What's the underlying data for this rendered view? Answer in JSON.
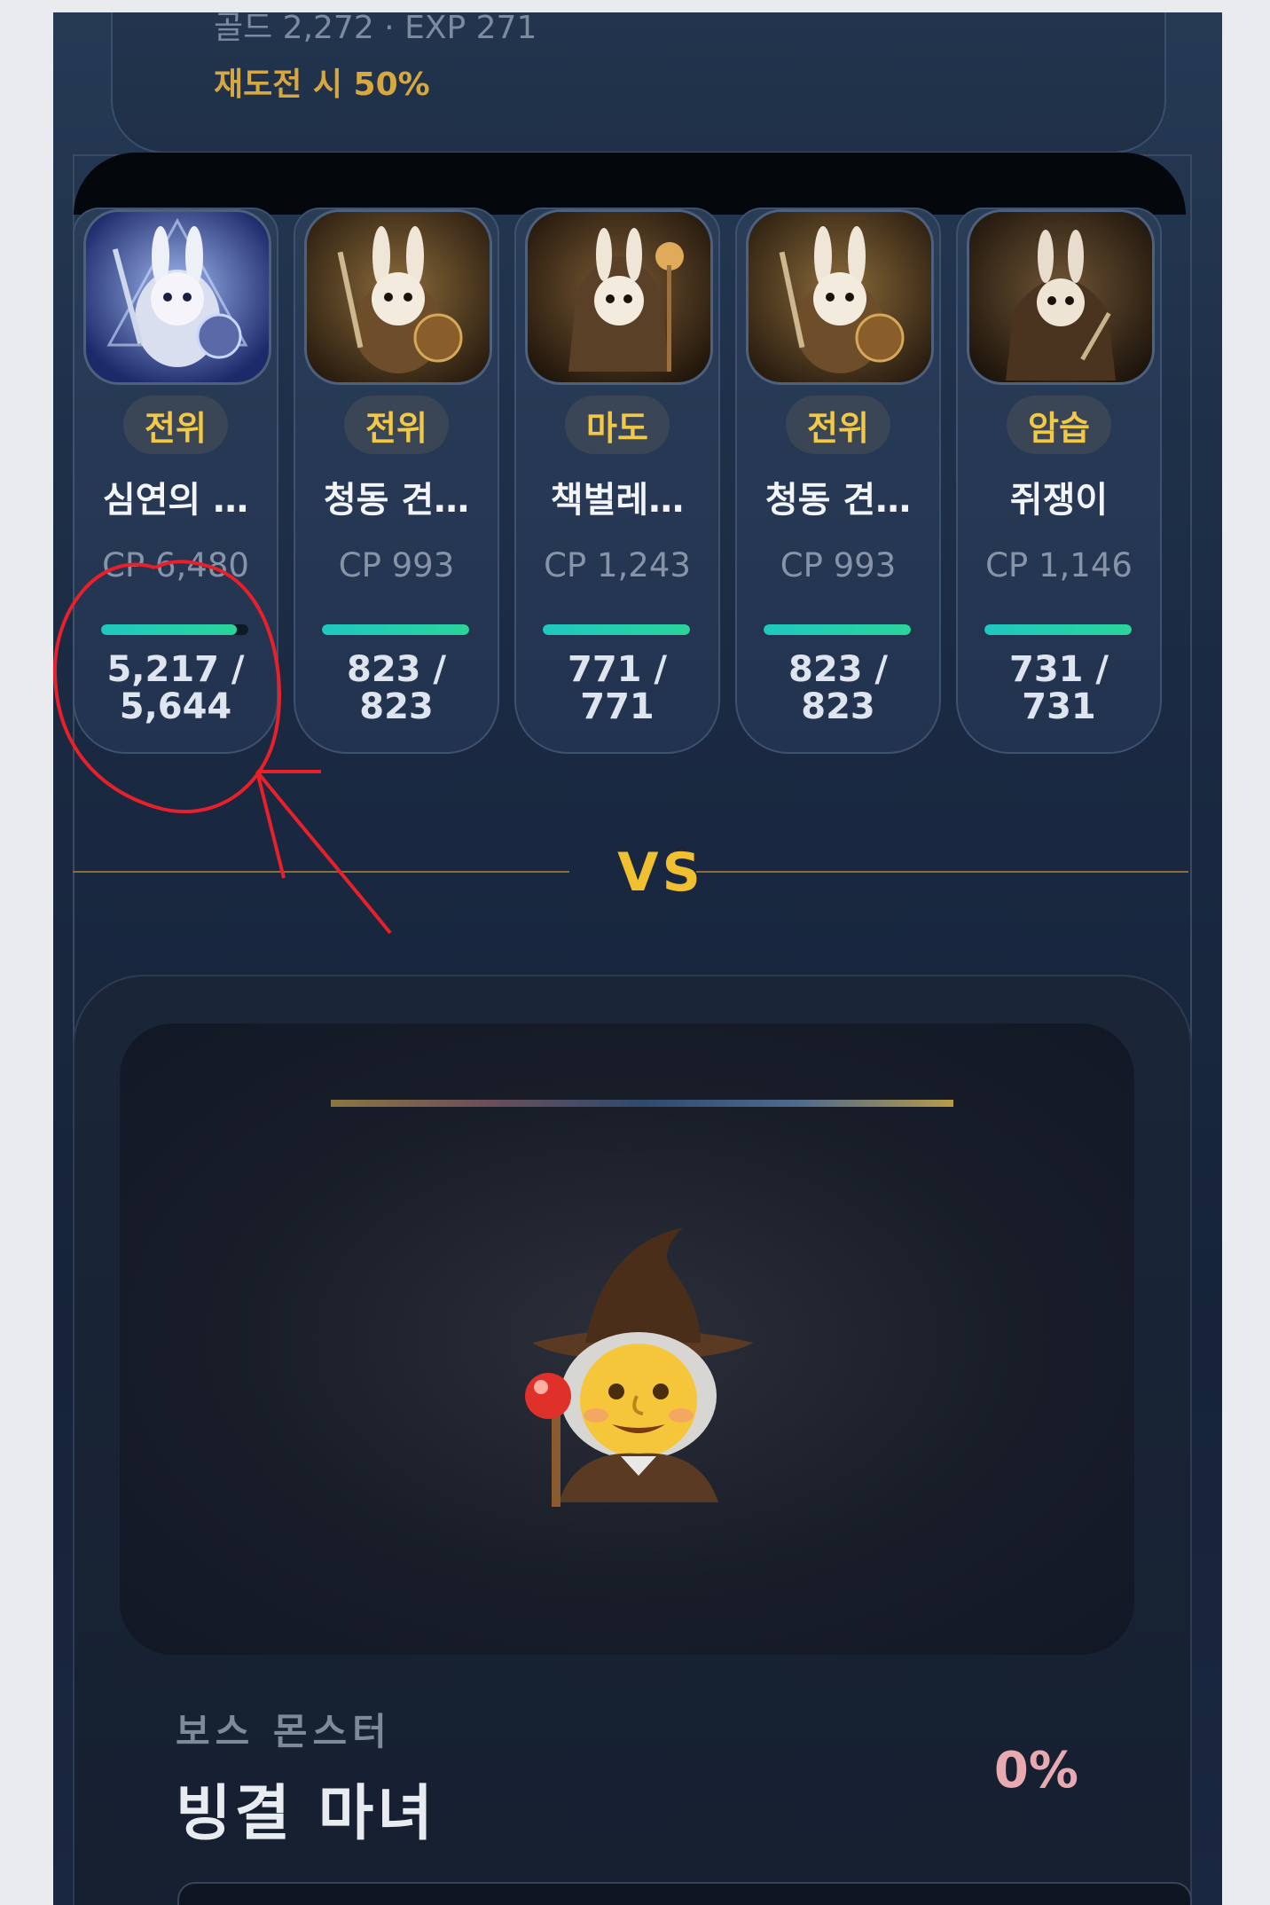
{
  "rewards": {
    "line": "골드 2,272 · EXP 271",
    "retry_note": "재도전 시 50%"
  },
  "team": [
    {
      "role": "전위",
      "name": "심연의 …",
      "cp": "CP 6,480",
      "hp_current": "5,217 /",
      "hp_max": "5,644",
      "hp_fraction": 0.924
    },
    {
      "role": "전위",
      "name": "청동 견…",
      "cp": "CP 993",
      "hp_current": "823 /",
      "hp_max": "823",
      "hp_fraction": 1.0
    },
    {
      "role": "마도",
      "name": "책벌레…",
      "cp": "CP 1,243",
      "hp_current": "771 /",
      "hp_max": "771",
      "hp_fraction": 1.0
    },
    {
      "role": "전위",
      "name": "청동 견…",
      "cp": "CP 993",
      "hp_current": "823 /",
      "hp_max": "823",
      "hp_fraction": 1.0
    },
    {
      "role": "암습",
      "name": "쥐쟁이",
      "cp": "CP 1,146",
      "hp_current": "731 /",
      "hp_max": "731",
      "hp_fraction": 1.0
    }
  ],
  "vs": "VS",
  "boss": {
    "label": "보스 몬스터",
    "name": "빙결 마녀",
    "progress": "0%",
    "icon": "witch-emoji"
  },
  "colors": {
    "accent_gold": "#f2c847",
    "hp_teal": "#1fc8c0",
    "annotation_red": "#e8202a"
  }
}
